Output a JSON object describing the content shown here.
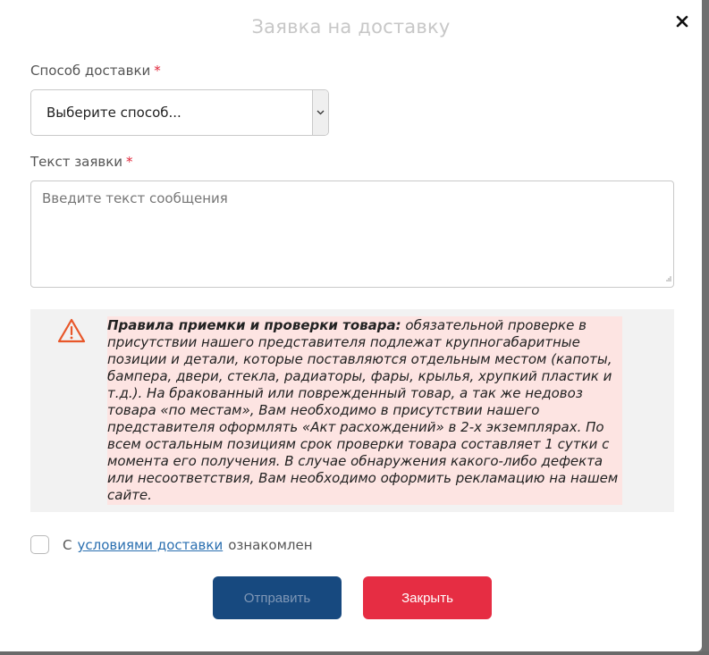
{
  "modal": {
    "title": "Заявка на доставку",
    "close_icon": "close-icon"
  },
  "delivery": {
    "label": "Способ доставки",
    "required_mark": "*",
    "selected": "Выберите способ..."
  },
  "request_text": {
    "label": "Текст заявки",
    "required_mark": "*",
    "placeholder": "Введите текст сообщения"
  },
  "notice": {
    "icon": "warning-icon",
    "heading": "Правила приемки и проверки товара:",
    "body": " обязательной проверке в присутствии нашего представителя подлежат крупногабаритные позиции и детали, которые поставляются отдельным местом (капоты, бампера, двери, стекла, радиаторы, фары, крылья, хрупкий пластик и т.д.). На бракованный или поврежденный товар, а так же недовоз товара «по местам», Вам необходимо в присутствии нашего представителя оформлять «Акт расхождений» в 2-х экземплярах. По всем остальным позициям срок проверки товара составляет 1 сутки с момента его получения. В случае обнаружения какого-либо дефекта или несоответствия, Вам необходимо оформить рекламацию на нашем сайте."
  },
  "agreement": {
    "prefix": "С",
    "link": "условиями доставки",
    "suffix": "ознакомлен"
  },
  "buttons": {
    "send": "Отправить",
    "close": "Закрыть"
  },
  "colors": {
    "send_button": "#17497f",
    "close_button": "#e62d43",
    "required": "#e0263a",
    "warning": "#e8572a",
    "notice_highlight": "#fde4e2"
  }
}
